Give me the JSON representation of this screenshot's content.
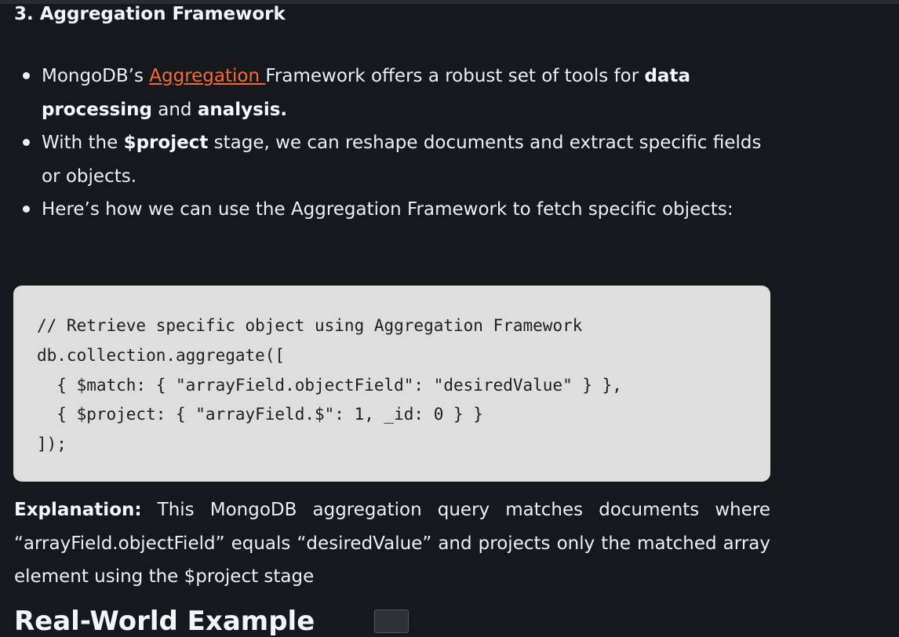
{
  "section": {
    "title": "3. Aggregation Framework"
  },
  "bullets": [
    {
      "pre": "MongoDB’s ",
      "link": "Aggregation ",
      "mid": "Framework offers a robust set of tools for ",
      "bold1": "data processing",
      "and": " and ",
      "bold2": "analysis."
    },
    {
      "pre": "With the ",
      "bold": "$project",
      "post": " stage, we can reshape documents and extract specific fields or objects."
    },
    {
      "text": "Here’s how we can use the Aggregation Framework to fetch specific objects:"
    }
  ],
  "code": {
    "lines": "// Retrieve specific object using Aggregation Framework\ndb.collection.aggregate([\n  { $match: { \"arrayField.objectField\": \"desiredValue\" } },\n  { $project: { \"arrayField.$\": 1, _id: 0 } }\n]);"
  },
  "explanation": {
    "label": "Explanation:",
    "text": " This MongoDB aggregation query matches documents where “arrayField.objectField” equals “desiredValue” and projects only the matched array element using the $project stage"
  },
  "next_heading": {
    "text": "Real-World Example"
  }
}
